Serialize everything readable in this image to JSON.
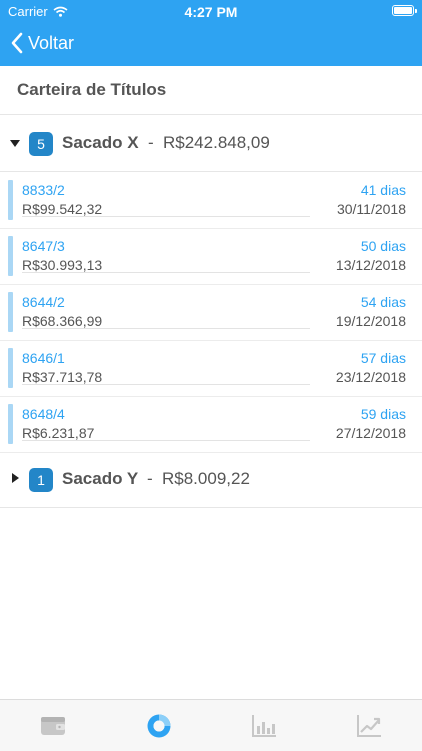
{
  "status": {
    "carrier": "Carrier",
    "time": "4:27 PM"
  },
  "nav": {
    "back_label": "Voltar"
  },
  "page": {
    "title": "Carteira de Títulos"
  },
  "groups": [
    {
      "count": "5",
      "name": "Sacado X",
      "separator": "-",
      "total": "R$242.848,09",
      "expanded": true
    },
    {
      "count": "1",
      "name": "Sacado Y",
      "separator": "-",
      "total": "R$8.009,22",
      "expanded": false
    }
  ],
  "items": [
    {
      "code": "8833/2",
      "amount": "R$99.542,32",
      "days": "41 dias",
      "date": "30/11/2018"
    },
    {
      "code": "8647/3",
      "amount": "R$30.993,13",
      "days": "50 dias",
      "date": "13/12/2018"
    },
    {
      "code": "8644/2",
      "amount": "R$68.366,99",
      "days": "54 dias",
      "date": "19/12/2018"
    },
    {
      "code": "8646/1",
      "amount": "R$37.713,78",
      "days": "57 dias",
      "date": "23/12/2018"
    },
    {
      "code": "8648/4",
      "amount": "R$6.231,87",
      "days": "59 dias",
      "date": "27/12/2018"
    }
  ],
  "tabs": [
    {
      "icon": "wallet-icon",
      "active": false
    },
    {
      "icon": "pie-chart-icon",
      "active": true
    },
    {
      "icon": "bar-chart-icon",
      "active": false
    },
    {
      "icon": "trend-chart-icon",
      "active": false
    }
  ],
  "colors": {
    "accent": "#2ea3f2",
    "badge": "#2386c8",
    "item_bar": "#aad7f5",
    "tab_inactive": "#c7c7c7"
  }
}
